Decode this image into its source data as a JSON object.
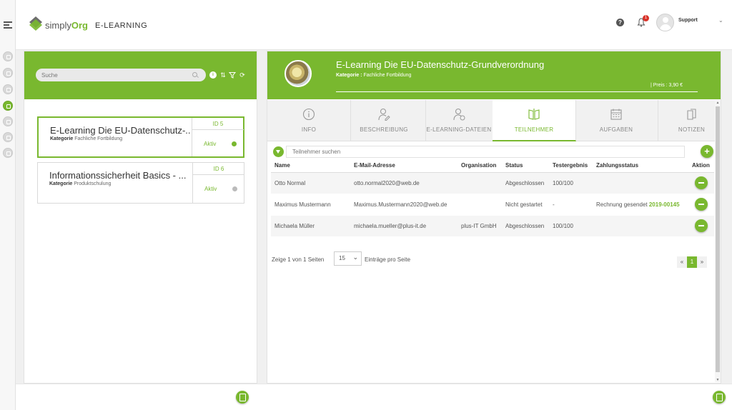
{
  "header": {
    "logo_prefix": "simply",
    "logo_suffix": "Org",
    "app_title": "E-LEARNING",
    "help_label": "?",
    "notifications_count": "1",
    "user_name": "Support"
  },
  "left": {
    "search_placeholder": "Suche",
    "tools": [
      "info-icon",
      "sort-icon",
      "filter-icon",
      "refresh-icon"
    ],
    "courses": [
      {
        "title": "E-Learning Die EU-Datenschutz-...",
        "category_label": "Kategorie",
        "category": "Fachliche Fortbildung",
        "id": "ID 5",
        "status": "Aktiv",
        "status_color": "#79b82f"
      },
      {
        "title": "Informationssicherheit Basics - ...",
        "category_label": "Kategorie",
        "category": "Produktschulung",
        "id": "ID 6",
        "status": "Aktiv",
        "status_color": "#bbbbbb"
      }
    ]
  },
  "right": {
    "title": "E-Learning Die EU-Datenschutz-Grundverordnung",
    "category_label": "Kategorie :",
    "category": "Fachliche Fortbildung",
    "price": "|   Preis : 3,90 €",
    "tabs": [
      {
        "label": "INFO",
        "icon": "info-icon"
      },
      {
        "label": "BESCHREIBUNG",
        "icon": "user-edit-icon"
      },
      {
        "label": "E-LEARNING-DATEIEN",
        "icon": "user-file-icon"
      },
      {
        "label": "TEILNEHMER",
        "icon": "book-icon",
        "active": true
      },
      {
        "label": "AUFGABEN",
        "icon": "calendar-icon"
      },
      {
        "label": "NOTIZEN",
        "icon": "notes-icon"
      }
    ],
    "participant_search_placeholder": "Teilnehmer suchen",
    "table": {
      "headers": [
        "Name",
        "E-Mail-Adresse",
        "Organisation",
        "Status",
        "Testergebnis",
        "Zahlungsstatus",
        "Aktion"
      ],
      "rows": [
        {
          "name": "Otto Normal",
          "email": "otto.normal2020@web.de",
          "org": "",
          "status": "Abgeschlossen",
          "result": "100/100",
          "payment": "",
          "invoice": ""
        },
        {
          "name": "Maximus Mustermann",
          "email": "Maximus.Mustermann2020@web.de",
          "org": "",
          "status": "Nicht gestartet",
          "result": "-",
          "payment": "Rechnung gesendet ",
          "invoice": "2019-00145"
        },
        {
          "name": "Michaela Müller",
          "email": "michaela.mueller@plus-it.de",
          "org": "plus-IT GmbH",
          "status": "Abgeschlossen",
          "result": "100/100",
          "payment": "",
          "invoice": ""
        }
      ]
    },
    "pagination": {
      "info": "Zeige 1 von 1 Seiten",
      "page_size": "15",
      "page_size_label": "Einträge pro Seite",
      "prev": "«",
      "current": "1",
      "next": "»"
    }
  },
  "colors": {
    "accent": "#79b82f",
    "badge": "#d9332a"
  }
}
